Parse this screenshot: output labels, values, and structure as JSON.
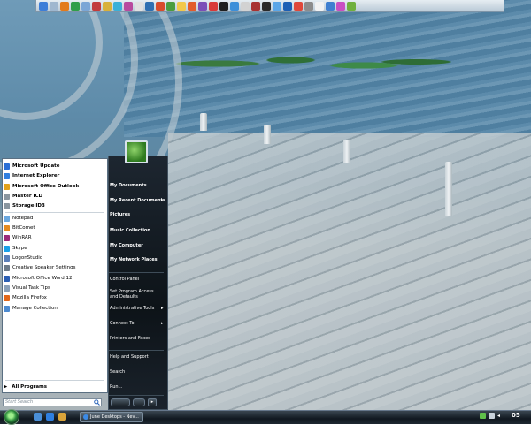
{
  "start_menu": {
    "pinned": [
      {
        "label": "Microsoft Update",
        "bold": true,
        "icon": "windows-update-icon",
        "color": "#2a6fd6"
      },
      {
        "label": "Internet Explorer",
        "bold": true,
        "icon": "internet-explorer-icon",
        "color": "#2f7fe0"
      },
      {
        "label": "Microsoft Office Outlook",
        "bold": true,
        "icon": "outlook-icon",
        "color": "#e3a21a"
      },
      {
        "label": "Master ICD",
        "bold": true,
        "icon": "drive-icon",
        "color": "#8a96a0"
      },
      {
        "label": "Storage ID3",
        "bold": true,
        "icon": "drive-icon",
        "color": "#8a96a0"
      }
    ],
    "recent": [
      {
        "label": "Notepad",
        "icon": "notepad-icon",
        "color": "#6aa8e0"
      },
      {
        "label": "BitComet",
        "icon": "bitcomet-icon",
        "color": "#e58a1f"
      },
      {
        "label": "WinRAR",
        "icon": "winrar-icon",
        "color": "#9c2a7a"
      },
      {
        "label": "Skype",
        "icon": "skype-icon",
        "color": "#1aa0e8"
      },
      {
        "label": "LogonStudio",
        "icon": "logonstudio-icon",
        "color": "#5a7fb8"
      },
      {
        "label": "Creative Speaker Settings",
        "icon": "speaker-icon",
        "color": "#6d7b88"
      },
      {
        "label": "Microsoft Office Word 12",
        "icon": "word-icon",
        "color": "#2b5fb4"
      },
      {
        "label": "Visual Task Tips",
        "icon": "task-tips-icon",
        "color": "#8aa0b8"
      },
      {
        "label": "Mozilla Firefox",
        "icon": "firefox-icon",
        "color": "#e2671a"
      },
      {
        "label": "Manage Collection",
        "icon": "collection-icon",
        "color": "#4c8ad0"
      }
    ],
    "all_programs": "All Programs",
    "search_placeholder": "Start Search",
    "places": [
      {
        "label": "My Documents",
        "bold": true,
        "arrow": false
      },
      {
        "label": "My Recent Documents",
        "bold": true,
        "arrow": true
      },
      {
        "label": "Pictures",
        "bold": true,
        "arrow": false
      },
      {
        "label": "Music Collection",
        "bold": true,
        "arrow": false
      },
      {
        "label": "My Computer",
        "bold": true,
        "arrow": false
      },
      {
        "label": "My Network Places",
        "bold": true,
        "arrow": false
      },
      {
        "label": "Control Panel",
        "bold": false,
        "arrow": false
      },
      {
        "label": "Set Program Access and Defaults",
        "bold": false,
        "arrow": false
      },
      {
        "label": "Administrative Tools",
        "bold": false,
        "arrow": true
      },
      {
        "label": "Connect To",
        "bold": false,
        "arrow": true
      },
      {
        "label": "Printers and Faxes",
        "bold": false,
        "arrow": false
      },
      {
        "label": "Help and Support",
        "bold": false,
        "arrow": false
      },
      {
        "label": "Search",
        "bold": false,
        "arrow": false
      },
      {
        "label": "Run...",
        "bold": false,
        "arrow": false
      }
    ]
  },
  "taskbar": {
    "task_label": "June Desktops - Nev...",
    "clock": "05"
  },
  "colors": {
    "accent": "#2c8d3c",
    "taskbar": "#111820",
    "menu_right": "#0d1318"
  }
}
